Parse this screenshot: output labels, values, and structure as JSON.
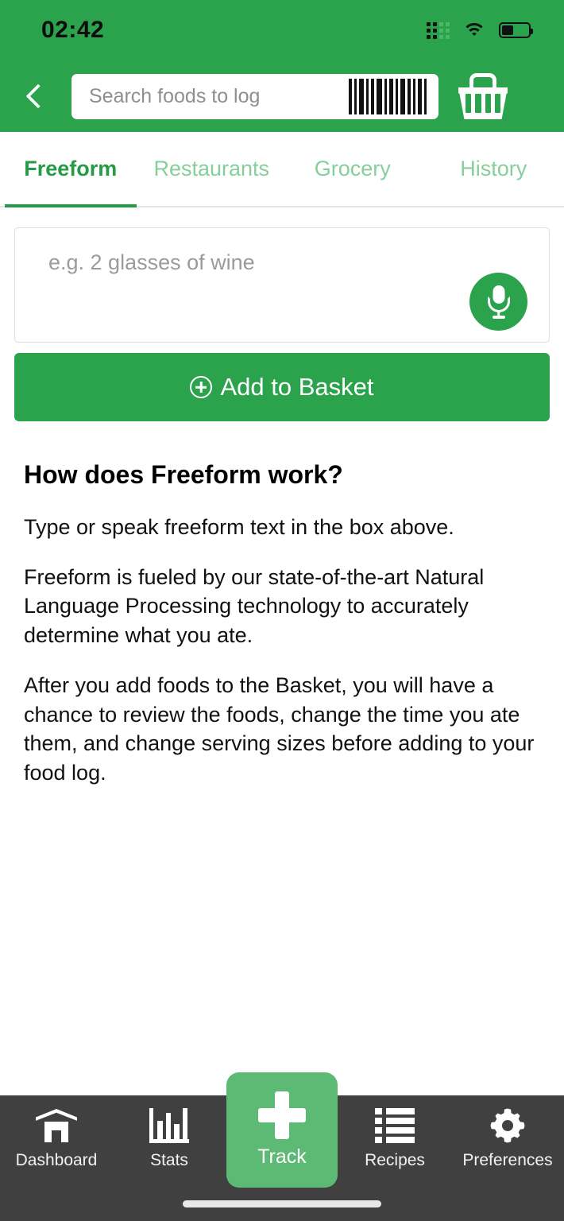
{
  "status_bar": {
    "time": "02:42",
    "signal_icon": "cellular-signal-icon",
    "wifi_icon": "wifi-icon",
    "battery_icon": "battery-icon"
  },
  "header": {
    "background_color": "#2ba24c",
    "back_icon": "back-chevron-icon",
    "search": {
      "placeholder": "Search foods to log",
      "value": "",
      "barcode_icon": "barcode-scan-icon"
    },
    "basket_icon": "shopping-basket-icon"
  },
  "tabs": {
    "active_index": 0,
    "active_color": "#259b45",
    "inactive_color": "#86cf9b",
    "items": [
      {
        "label": "Freeform"
      },
      {
        "label": "Restaurants"
      },
      {
        "label": "Grocery"
      },
      {
        "label": "History"
      }
    ]
  },
  "freeform": {
    "input_placeholder": "e.g. 2 glasses of wine",
    "input_value": "",
    "mic_icon": "microphone-icon",
    "add_button_label": "Add to Basket",
    "add_button_icon": "plus-circle-icon",
    "add_button_color": "#2ba24c"
  },
  "help": {
    "heading": "How does Freeform work?",
    "paragraphs": [
      "Type or speak freeform text in the box above.",
      "Freeform is fueled by our state-of-the-art Natural Language Processing technology to accurately determine what you ate.",
      "After you add foods to the Basket, you will have a chance to review the foods, change the time you ate them, and change serving sizes before adding to your food log."
    ]
  },
  "bottom_nav": {
    "background_color": "#404040",
    "track_color": "#5cba74",
    "items": [
      {
        "label": "Dashboard",
        "icon": "home-icon"
      },
      {
        "label": "Stats",
        "icon": "bar-chart-icon"
      },
      {
        "label": "Track",
        "icon": "plus-icon"
      },
      {
        "label": "Recipes",
        "icon": "list-icon"
      },
      {
        "label": "Preferences",
        "icon": "gear-icon"
      }
    ]
  }
}
